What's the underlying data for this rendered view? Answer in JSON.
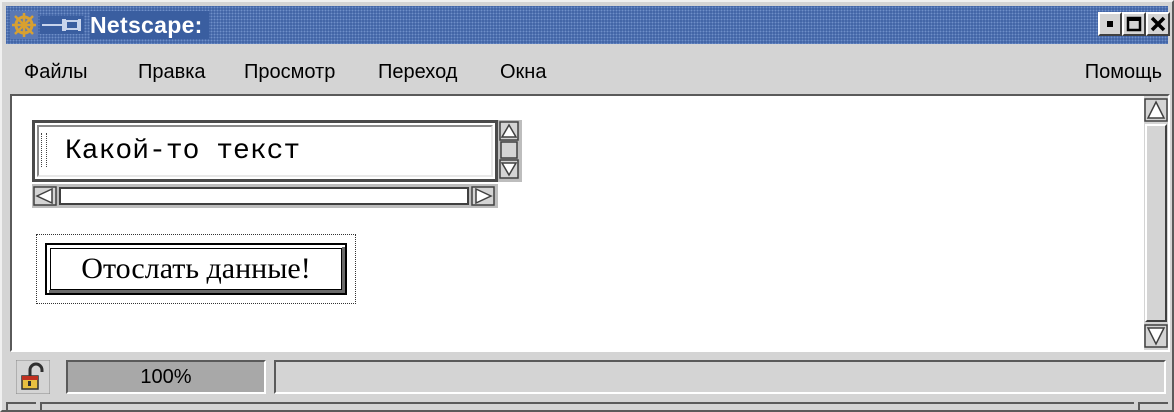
{
  "window": {
    "title": "Netscape:",
    "title_color": "#3a5ea0",
    "controls": {
      "minimize_icon": "minimize-icon",
      "maximize_icon": "maximize-icon",
      "close_icon": "close-icon"
    }
  },
  "menu": {
    "items": [
      "Файлы",
      "Правка",
      "Просмотр",
      "Переход",
      "Окна"
    ],
    "help": "Помощь"
  },
  "form": {
    "textarea_value": "Какой-то текст",
    "submit_label": "Отослать данные!"
  },
  "status": {
    "progress_text": "100%",
    "progress": 1.0,
    "message": "",
    "security_icon": "padlock-open-icon"
  }
}
